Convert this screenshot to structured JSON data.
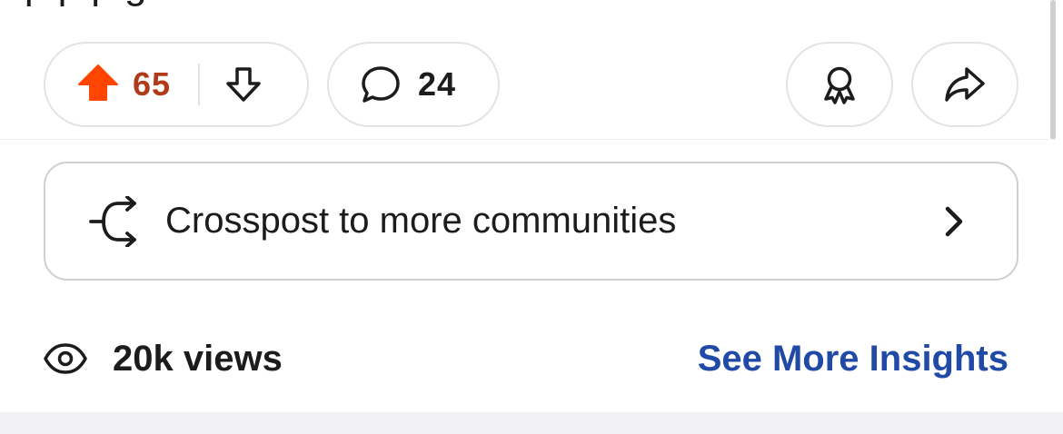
{
  "post_body": {
    "cut_text": "r                    p                                    p p    g"
  },
  "actions": {
    "score": "65",
    "comment_count": "24",
    "upvote_color": "#ff4500",
    "score_color": "#b03a19"
  },
  "crosspost": {
    "label": "Crosspost to more communities"
  },
  "insights": {
    "views": "20k views",
    "link_label": "See More Insights",
    "link_color": "#2149a6"
  },
  "icons": {
    "upvote": "upvote-arrow-icon",
    "downvote": "downvote-arrow-icon",
    "comment": "comment-bubble-icon",
    "award": "award-icon",
    "share": "share-arrow-icon",
    "crosspost": "crosspost-icon",
    "chevron": "chevron-right-icon",
    "views": "eye-icon"
  }
}
